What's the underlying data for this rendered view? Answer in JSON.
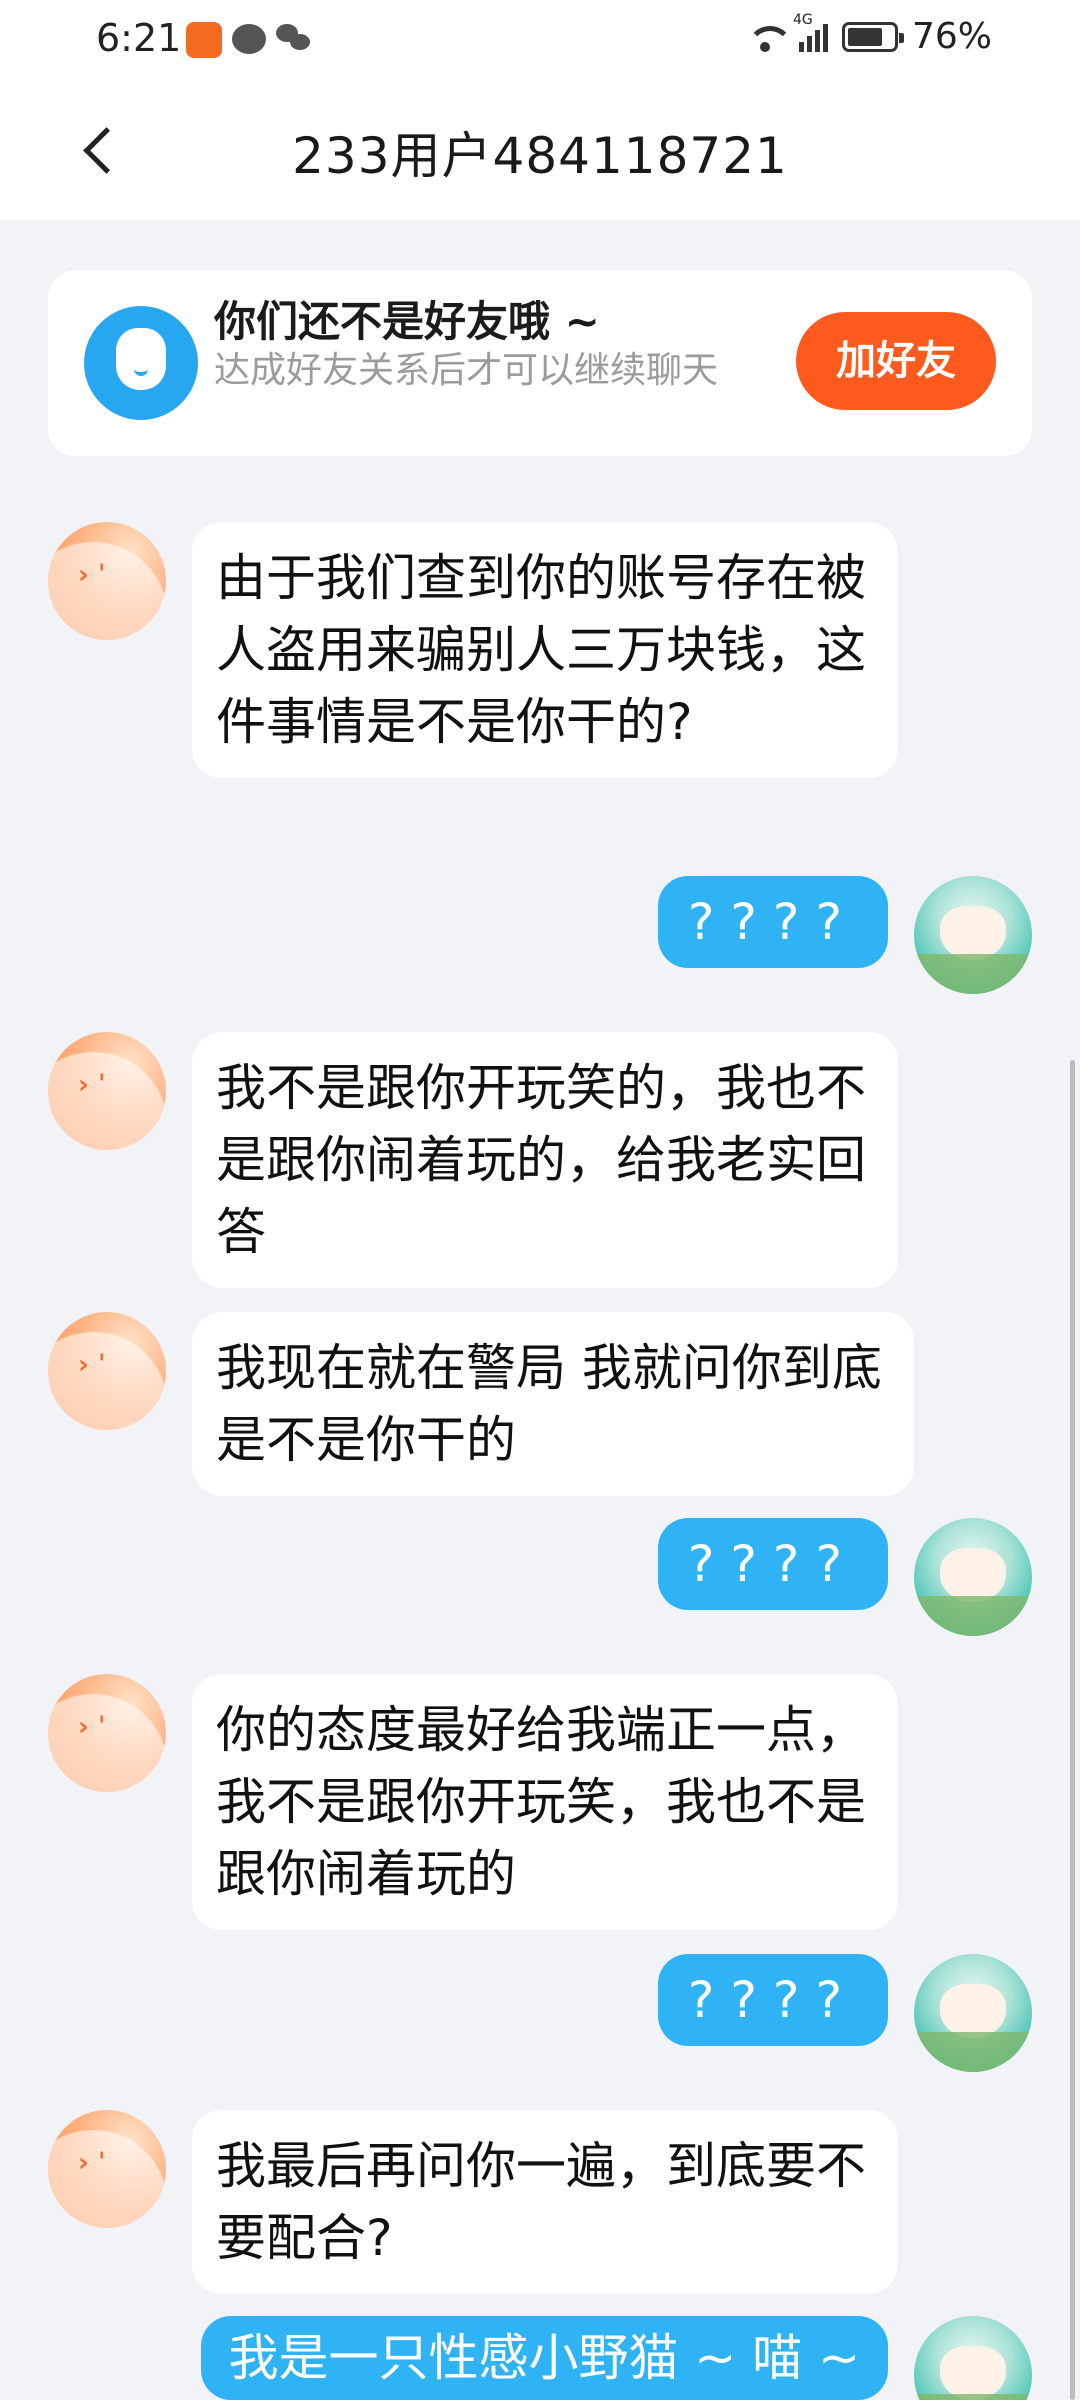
{
  "status_bar": {
    "time": "6:21",
    "network": "4G",
    "battery": "76%"
  },
  "header": {
    "title": "233用户484118721"
  },
  "friend_card": {
    "title": "你们还不是好友哦 ~",
    "subtitle": "达成好友关系后才可以继续聊天",
    "add_button": "加好友"
  },
  "messages": [
    {
      "side": "left",
      "text": "由于我们查到你的账号存在被人盗用来骗别人三万块钱，这件事情是不是你干的?"
    },
    {
      "side": "right",
      "text": "????"
    },
    {
      "side": "left",
      "text": "我不是跟你开玩笑的，我也不是跟你闹着玩的，给我老实回答"
    },
    {
      "side": "left",
      "text": "我现在就在警局 我就问你到底是不是你干的"
    },
    {
      "side": "right",
      "text": "????"
    },
    {
      "side": "left",
      "text": "你的态度最好给我端正一点，我不是跟你开玩笑，我也不是跟你闹着玩的"
    },
    {
      "side": "right",
      "text": "????"
    },
    {
      "side": "left",
      "text": "我最后再问你一遍，到底要不要配合?"
    },
    {
      "side": "right",
      "text": "我是一只性感小野猫 ~ 喵 ~"
    }
  ]
}
